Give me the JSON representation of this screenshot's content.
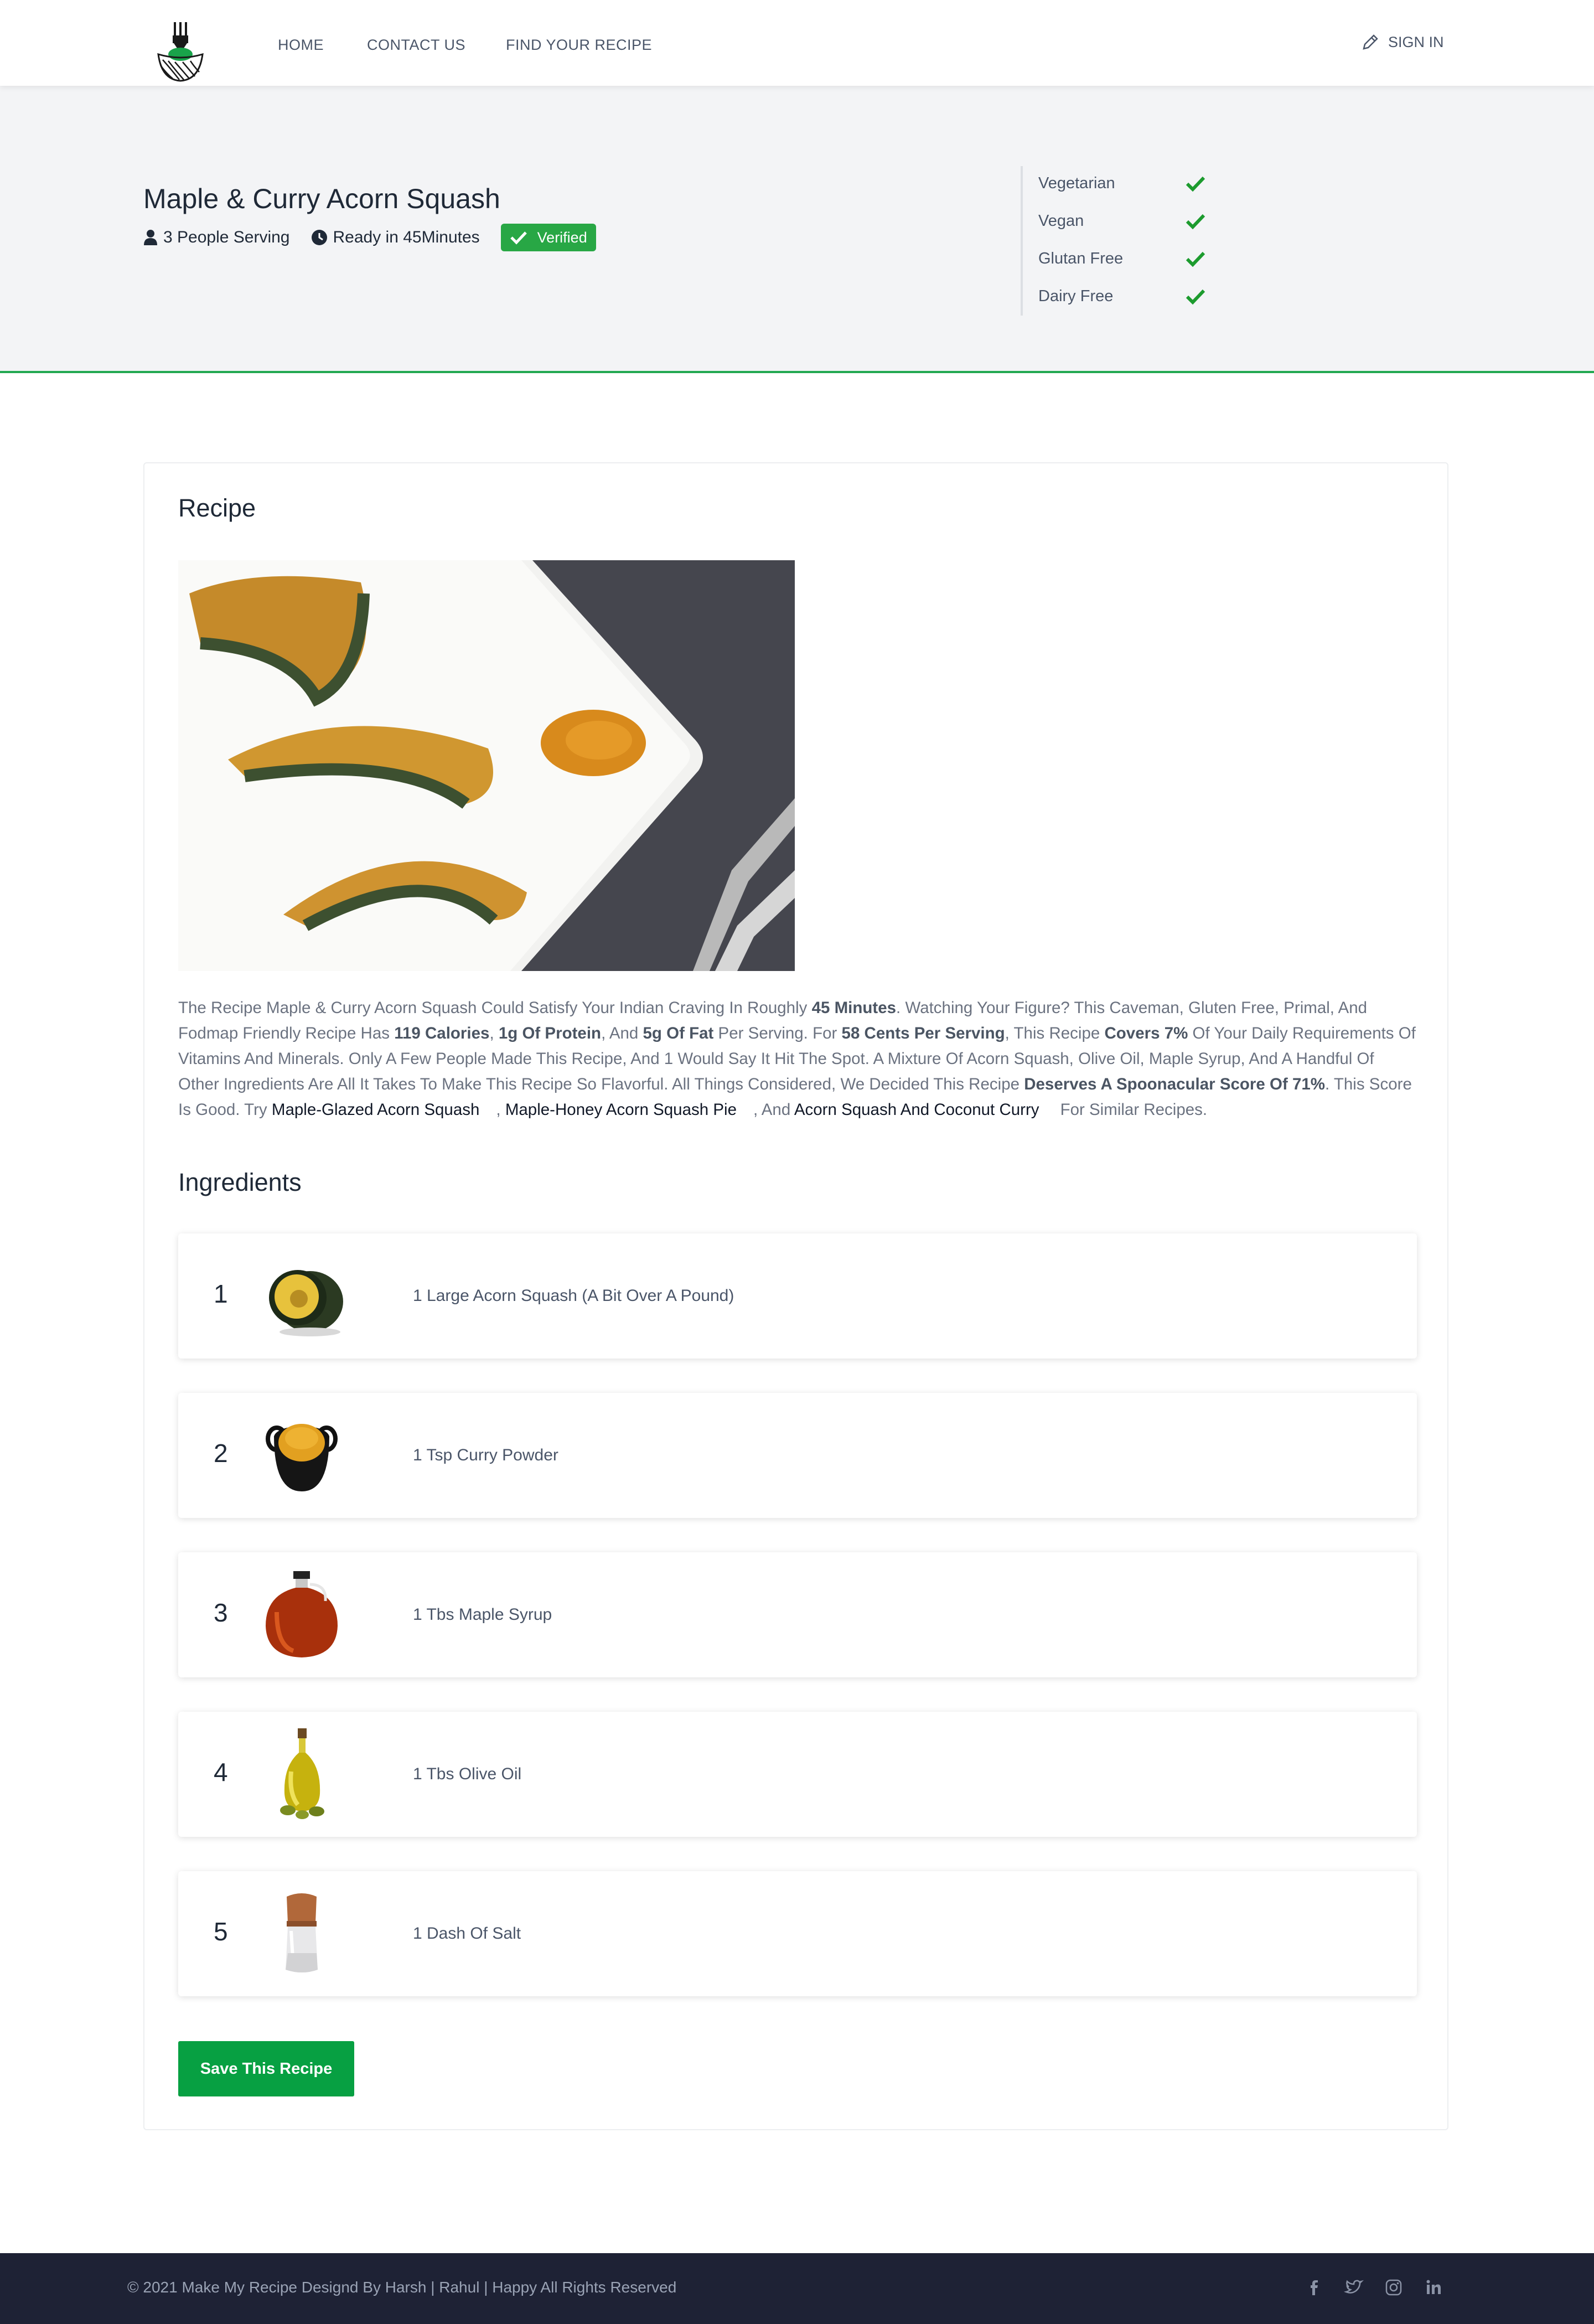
{
  "nav": {
    "links": [
      "HOME",
      "CONTACT US",
      "FIND YOUR RECIPE"
    ],
    "signin": "SIGN IN"
  },
  "recipe": {
    "title": "Maple & Curry Acorn Squash",
    "servings": "3 People Serving",
    "ready": "Ready in 45Minutes",
    "badge": "Verified",
    "diets": [
      {
        "label": "Vegetarian",
        "value": true
      },
      {
        "label": "Vegan",
        "value": true
      },
      {
        "label": "Glutan Free",
        "value": true
      },
      {
        "label": "Dairy Free",
        "value": true
      }
    ]
  },
  "card": {
    "heading": "Recipe",
    "ingredients_heading": "Ingredients",
    "description": {
      "t1": "The Recipe Maple & Curry Acorn Squash Could Satisfy Your Indian Craving In Roughly ",
      "b1": "45 Minutes",
      "t2": ". Watching Your Figure? This Caveman, Gluten Free, Primal, And Fodmap Friendly Recipe Has ",
      "b2": "119 Calories",
      "t3": ", ",
      "b3": "1g Of Protein",
      "t4": ", And ",
      "b4": "5g Of Fat",
      "t5": " Per Serving. For ",
      "b5": "58 Cents Per Serving",
      "t6": ", This Recipe ",
      "b6": "Covers 7%",
      "t7": " Of Your Daily Requirements Of Vitamins And Minerals. Only A Few People Made This Recipe, And 1 Would Say It Hit The Spot. A Mixture Of Acorn Squash, Olive Oil, Maple Syrup, And A Handful Of Other Ingredients Are All It Takes To Make This Recipe So Flavorful. All Things Considered, We Decided This Recipe ",
      "b7": "Deserves A Spoonacular Score Of 71%",
      "t8": ". This Score Is Good. Try ",
      "l1": "Maple-Glazed Acorn Squash",
      "t9": ", ",
      "l2": "Maple-Honey Acorn Squash Pie",
      "t10": ", And ",
      "l3": "Acorn Squash And Coconut Curry",
      "t11": "For Similar Recipes."
    },
    "ingredients": [
      {
        "num": "1",
        "text": "1 Large Acorn Squash (A Bit Over A Pound)",
        "icon": "acorn-squash"
      },
      {
        "num": "2",
        "text": "1 Tsp Curry Powder",
        "icon": "curry-powder"
      },
      {
        "num": "3",
        "text": "1 Tbs Maple Syrup",
        "icon": "maple-syrup"
      },
      {
        "num": "4",
        "text": "1 Tbs Olive Oil",
        "icon": "olive-oil"
      },
      {
        "num": "5",
        "text": "1 Dash Of Salt",
        "icon": "salt"
      }
    ],
    "save_label": "Save This Recipe"
  },
  "footer": {
    "copyright": "© 2021 Make My Recipe Designd By Harsh | Rahul | Happy All Rights Reserved",
    "social": [
      "facebook-icon",
      "twitter-icon",
      "instagram-icon",
      "linkedin-icon"
    ]
  },
  "colors": {
    "accent_green": "#07a042",
    "check_green": "#1c9b2e",
    "footer_bg": "#1e2235",
    "hero_bg": "#f3f4f6"
  }
}
